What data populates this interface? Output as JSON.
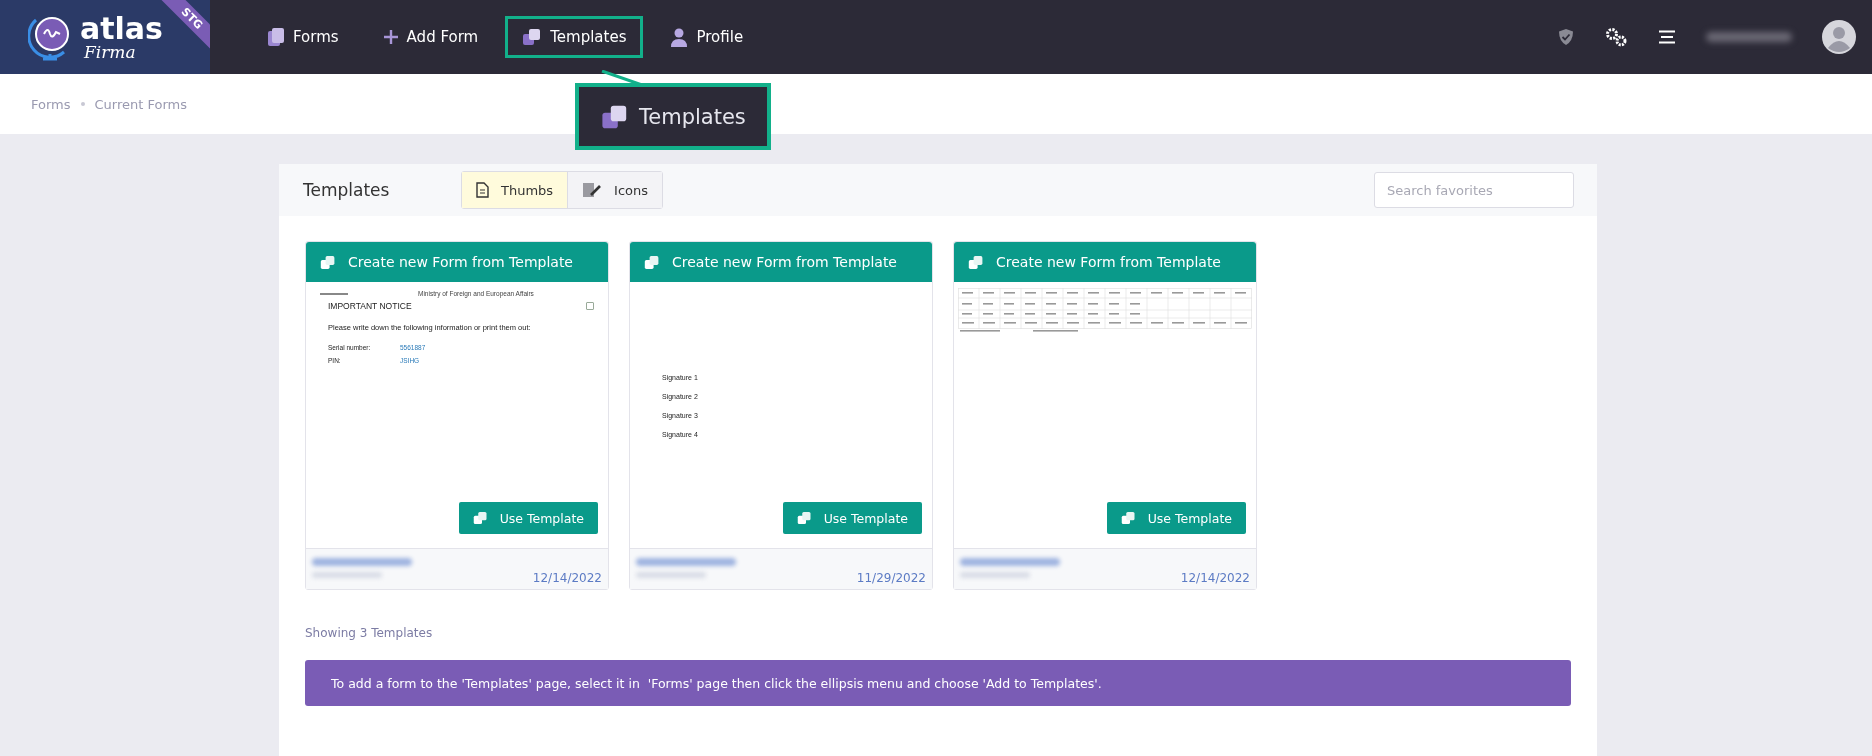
{
  "logo": {
    "name": "atlas",
    "script": "Firma",
    "badge": "STG"
  },
  "nav": [
    {
      "label": "Forms",
      "highlighted": false
    },
    {
      "label": "Add Form",
      "highlighted": false
    },
    {
      "label": "Templates",
      "highlighted": true
    },
    {
      "label": "Profile",
      "highlighted": false
    }
  ],
  "callout": {
    "label": "Templates"
  },
  "breadcrumb": [
    "Forms",
    "Current Forms"
  ],
  "panel": {
    "title": "Templates",
    "view_toggle": [
      {
        "label": "Thumbs",
        "selected": true
      },
      {
        "label": "Icons",
        "selected": false
      }
    ],
    "search": {
      "placeholder": "Search favorites"
    }
  },
  "templates": [
    {
      "header": "Create new Form from Template",
      "thumbnail": {
        "kind": "notice",
        "agency": "Ministry of Foreign and European Affairs",
        "title": "IMPORTANT NOTICE",
        "checked": false,
        "intro": "Please write down the following information or print them out:",
        "fields": [
          {
            "label": "Serial number:",
            "value": "5561887"
          },
          {
            "label": "PIN:",
            "value": "JSIHG"
          }
        ]
      },
      "button": "Use Template",
      "date": "12/14/2022"
    },
    {
      "header": "Create new Form from Template",
      "thumbnail": {
        "kind": "signatures",
        "lines": [
          "Signature 1",
          "Signature 2",
          "Signature 3",
          "Signature 4"
        ]
      },
      "button": "Use Template",
      "date": "11/29/2022"
    },
    {
      "header": "Create new Form from Template",
      "thumbnail": {
        "kind": "table"
      },
      "button": "Use Template",
      "date": "12/14/2022"
    }
  ],
  "count": "Showing 3 Templates",
  "info": "To add a form to the 'Templates' page, select it in  'Forms' page then click the ellipsis menu and choose 'Add to Templates'."
}
